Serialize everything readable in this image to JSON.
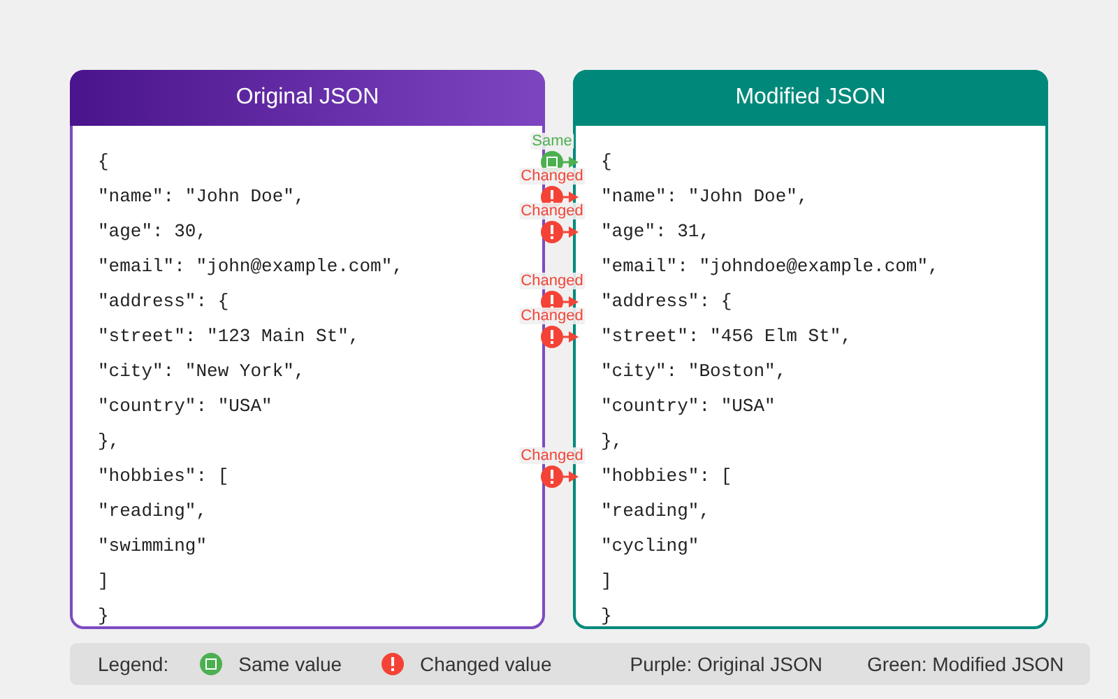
{
  "panels": [
    {
      "title": "Original JSON",
      "kind": "original"
    },
    {
      "title": "Modified JSON",
      "kind": "modified"
    }
  ],
  "rows": [
    {
      "original": "{",
      "modified": "{",
      "marker": {
        "kind": "same",
        "label": "Same"
      }
    },
    {
      "original": "\"name\": \"John Doe\",",
      "modified": "\"name\": \"John Doe\",",
      "marker": {
        "kind": "changed",
        "label": "Changed"
      }
    },
    {
      "original": "\"age\": 30,",
      "modified": "\"age\": 31,",
      "marker": {
        "kind": "changed",
        "label": "Changed"
      }
    },
    {
      "original": "\"email\": \"john@example.com\",",
      "modified": "\"email\": \"johndoe@example.com\","
    },
    {
      "original": "\"address\": {",
      "modified": "\"address\": {",
      "marker": {
        "kind": "changed",
        "label": "Changed"
      }
    },
    {
      "original": "\"street\": \"123 Main St\",",
      "modified": "\"street\": \"456 Elm St\",",
      "marker": {
        "kind": "changed",
        "label": "Changed"
      }
    },
    {
      "original": "\"city\": \"New York\",",
      "modified": "\"city\": \"Boston\","
    },
    {
      "original": "\"country\": \"USA\"",
      "modified": "\"country\": \"USA\""
    },
    {
      "original": "},",
      "modified": "},"
    },
    {
      "original": "\"hobbies\": [",
      "modified": "\"hobbies\": [",
      "marker": {
        "kind": "changed",
        "label": "Changed"
      }
    },
    {
      "original": "\"reading\",",
      "modified": "\"reading\","
    },
    {
      "original": "\"swimming\"",
      "modified": "\"cycling\""
    },
    {
      "original": "]",
      "modified": "]"
    },
    {
      "original": "}",
      "modified": "}"
    }
  ],
  "legend": {
    "title": "Legend:",
    "items": [
      {
        "kind": "same",
        "label": "Same value"
      },
      {
        "kind": "changed",
        "label": "Changed value"
      }
    ],
    "notes": [
      "Purple: Original JSON",
      "Green: Modified JSON"
    ]
  }
}
